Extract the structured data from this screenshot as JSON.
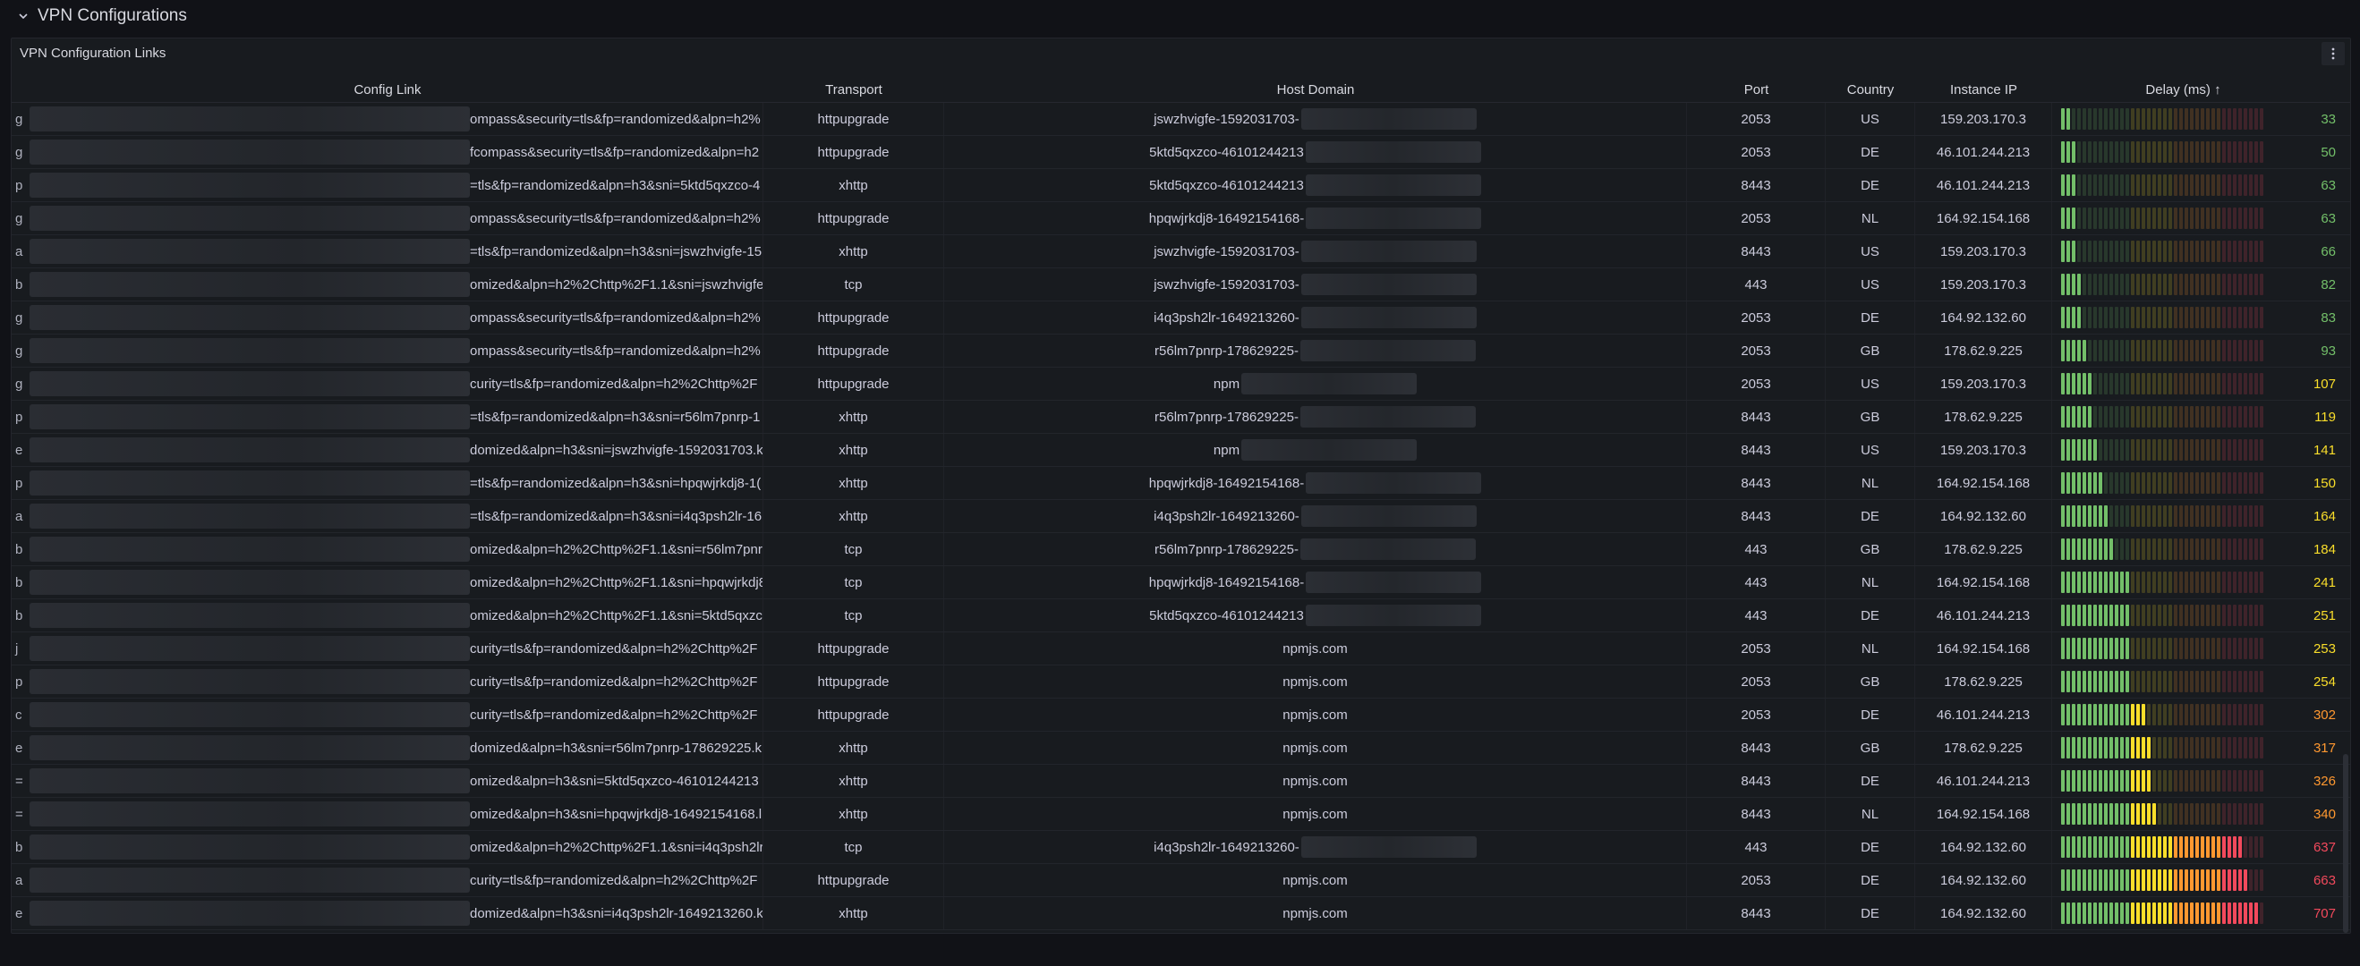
{
  "section": {
    "title": "VPN Configurations"
  },
  "panel": {
    "title": "VPN Configuration Links"
  },
  "columns": {
    "link": "Config Link",
    "transport": "Transport",
    "host": "Host Domain",
    "port": "Port",
    "country": "Country",
    "ip": "Instance IP",
    "delay": "Delay (ms) ↑"
  },
  "colors": {
    "green": "#73bf69",
    "yellow": "#fade2a",
    "orange": "#ff9830",
    "red": "#f2495c"
  },
  "gauge_max_ms": 720,
  "rows": [
    {
      "prefix": "g",
      "tail": "ompass&security=tls&fp=randomized&alpn=h2%",
      "transport": "httpupgrade",
      "host": "jswzhvigfe-1592031703-",
      "host_blur": true,
      "port": "2053",
      "country": "US",
      "ip": "159.203.170.3",
      "delay": "33",
      "delay_ms": 33
    },
    {
      "prefix": "g",
      "tail": "fcompass&security=tls&fp=randomized&alpn=h2",
      "transport": "httpupgrade",
      "host": "5ktd5qxzco-46101244213",
      "host_blur": true,
      "port": "2053",
      "country": "DE",
      "ip": "46.101.244.213",
      "delay": "50",
      "delay_ms": 50
    },
    {
      "prefix": "p",
      "tail": "=tls&fp=randomized&alpn=h3&sni=5ktd5qxzco-4",
      "transport": "xhttp",
      "host": "5ktd5qxzco-46101244213",
      "host_blur": true,
      "port": "8443",
      "country": "DE",
      "ip": "46.101.244.213",
      "delay": "63",
      "delay_ms": 63
    },
    {
      "prefix": "g",
      "tail": "ompass&security=tls&fp=randomized&alpn=h2%",
      "transport": "httpupgrade",
      "host": "hpqwjrkdj8-16492154168-",
      "host_blur": true,
      "port": "2053",
      "country": "NL",
      "ip": "164.92.154.168",
      "delay": "63",
      "delay_ms": 63
    },
    {
      "prefix": "a",
      "tail": "=tls&fp=randomized&alpn=h3&sni=jswzhvigfe-15",
      "transport": "xhttp",
      "host": "jswzhvigfe-1592031703-",
      "host_blur": true,
      "port": "8443",
      "country": "US",
      "ip": "159.203.170.3",
      "delay": "66",
      "delay_ms": 66
    },
    {
      "prefix": "b",
      "tail": "omized&alpn=h2%2Chttp%2F1.1&sni=jswzhvigfe-",
      "transport": "tcp",
      "host": "jswzhvigfe-1592031703-",
      "host_blur": true,
      "port": "443",
      "country": "US",
      "ip": "159.203.170.3",
      "delay": "82",
      "delay_ms": 82
    },
    {
      "prefix": "g",
      "tail": "ompass&security=tls&fp=randomized&alpn=h2%",
      "transport": "httpupgrade",
      "host": "i4q3psh2lr-1649213260-",
      "host_blur": true,
      "port": "2053",
      "country": "DE",
      "ip": "164.92.132.60",
      "delay": "83",
      "delay_ms": 83
    },
    {
      "prefix": "g",
      "tail": "ompass&security=tls&fp=randomized&alpn=h2%",
      "transport": "httpupgrade",
      "host": "r56lm7pnrp-178629225-",
      "host_blur": true,
      "port": "2053",
      "country": "GB",
      "ip": "178.62.9.225",
      "delay": "93",
      "delay_ms": 93
    },
    {
      "prefix": "g",
      "tail": "curity=tls&fp=randomized&alpn=h2%2Chttp%2F",
      "transport": "httpupgrade",
      "host": "npm",
      "host_blur": true,
      "port": "2053",
      "country": "US",
      "ip": "159.203.170.3",
      "delay": "107",
      "delay_ms": 107
    },
    {
      "prefix": "p",
      "tail": "=tls&fp=randomized&alpn=h3&sni=r56lm7pnrp-1",
      "transport": "xhttp",
      "host": "r56lm7pnrp-178629225-",
      "host_blur": true,
      "port": "8443",
      "country": "GB",
      "ip": "178.62.9.225",
      "delay": "119",
      "delay_ms": 119
    },
    {
      "prefix": "e",
      "tail": "domized&alpn=h3&sni=jswzhvigfe-1592031703.k",
      "transport": "xhttp",
      "host": "npm",
      "host_blur": true,
      "port": "8443",
      "country": "US",
      "ip": "159.203.170.3",
      "delay": "141",
      "delay_ms": 141
    },
    {
      "prefix": "p",
      "tail": "=tls&fp=randomized&alpn=h3&sni=hpqwjrkdj8-1(",
      "transport": "xhttp",
      "host": "hpqwjrkdj8-16492154168-",
      "host_blur": true,
      "port": "8443",
      "country": "NL",
      "ip": "164.92.154.168",
      "delay": "150",
      "delay_ms": 150
    },
    {
      "prefix": "a",
      "tail": "=tls&fp=randomized&alpn=h3&sni=i4q3psh2lr-16",
      "transport": "xhttp",
      "host": "i4q3psh2lr-1649213260-",
      "host_blur": true,
      "port": "8443",
      "country": "DE",
      "ip": "164.92.132.60",
      "delay": "164",
      "delay_ms": 164
    },
    {
      "prefix": "b",
      "tail": "omized&alpn=h2%2Chttp%2F1.1&sni=r56lm7pnrp",
      "transport": "tcp",
      "host": "r56lm7pnrp-178629225-",
      "host_blur": true,
      "port": "443",
      "country": "GB",
      "ip": "178.62.9.225",
      "delay": "184",
      "delay_ms": 184
    },
    {
      "prefix": "b",
      "tail": "omized&alpn=h2%2Chttp%2F1.1&sni=hpqwjrkdj8",
      "transport": "tcp",
      "host": "hpqwjrkdj8-16492154168-",
      "host_blur": true,
      "port": "443",
      "country": "NL",
      "ip": "164.92.154.168",
      "delay": "241",
      "delay_ms": 241
    },
    {
      "prefix": "b",
      "tail": "omized&alpn=h2%2Chttp%2F1.1&sni=5ktd5qxzco",
      "transport": "tcp",
      "host": "5ktd5qxzco-46101244213",
      "host_blur": true,
      "port": "443",
      "country": "DE",
      "ip": "46.101.244.213",
      "delay": "251",
      "delay_ms": 251
    },
    {
      "prefix": "j",
      "tail": "curity=tls&fp=randomized&alpn=h2%2Chttp%2F",
      "transport": "httpupgrade",
      "host": "npmjs.com",
      "host_blur": false,
      "port": "2053",
      "country": "NL",
      "ip": "164.92.154.168",
      "delay": "253",
      "delay_ms": 253
    },
    {
      "prefix": "p",
      "tail": "curity=tls&fp=randomized&alpn=h2%2Chttp%2F",
      "transport": "httpupgrade",
      "host": "npmjs.com",
      "host_blur": false,
      "port": "2053",
      "country": "GB",
      "ip": "178.62.9.225",
      "delay": "254",
      "delay_ms": 254
    },
    {
      "prefix": "c",
      "tail": "curity=tls&fp=randomized&alpn=h2%2Chttp%2F",
      "transport": "httpupgrade",
      "host": "npmjs.com",
      "host_blur": false,
      "port": "2053",
      "country": "DE",
      "ip": "46.101.244.213",
      "delay": "302",
      "delay_ms": 302
    },
    {
      "prefix": "e",
      "tail": "domized&alpn=h3&sni=r56lm7pnrp-178629225.k",
      "transport": "xhttp",
      "host": "npmjs.com",
      "host_blur": false,
      "port": "8443",
      "country": "GB",
      "ip": "178.62.9.225",
      "delay": "317",
      "delay_ms": 317
    },
    {
      "prefix": "=",
      "tail": "omized&alpn=h3&sni=5ktd5qxzco-46101244213",
      "transport": "xhttp",
      "host": "npmjs.com",
      "host_blur": false,
      "port": "8443",
      "country": "DE",
      "ip": "46.101.244.213",
      "delay": "326",
      "delay_ms": 326
    },
    {
      "prefix": "=",
      "tail": "omized&alpn=h3&sni=hpqwjrkdj8-16492154168.l",
      "transport": "xhttp",
      "host": "npmjs.com",
      "host_blur": false,
      "port": "8443",
      "country": "NL",
      "ip": "164.92.154.168",
      "delay": "340",
      "delay_ms": 340
    },
    {
      "prefix": "b",
      "tail": "omized&alpn=h2%2Chttp%2F1.1&sni=i4q3psh2lr-",
      "transport": "tcp",
      "host": "i4q3psh2lr-1649213260-",
      "host_blur": true,
      "port": "443",
      "country": "DE",
      "ip": "164.92.132.60",
      "delay": "637",
      "delay_ms": 637
    },
    {
      "prefix": "a",
      "tail": "curity=tls&fp=randomized&alpn=h2%2Chttp%2F",
      "transport": "httpupgrade",
      "host": "npmjs.com",
      "host_blur": false,
      "port": "2053",
      "country": "DE",
      "ip": "164.92.132.60",
      "delay": "663",
      "delay_ms": 663
    },
    {
      "prefix": "e",
      "tail": "domized&alpn=h3&sni=i4q3psh2lr-1649213260.k",
      "transport": "xhttp",
      "host": "npmjs.com",
      "host_blur": false,
      "port": "8443",
      "country": "DE",
      "ip": "164.92.132.60",
      "delay": "707",
      "delay_ms": 707
    }
  ]
}
